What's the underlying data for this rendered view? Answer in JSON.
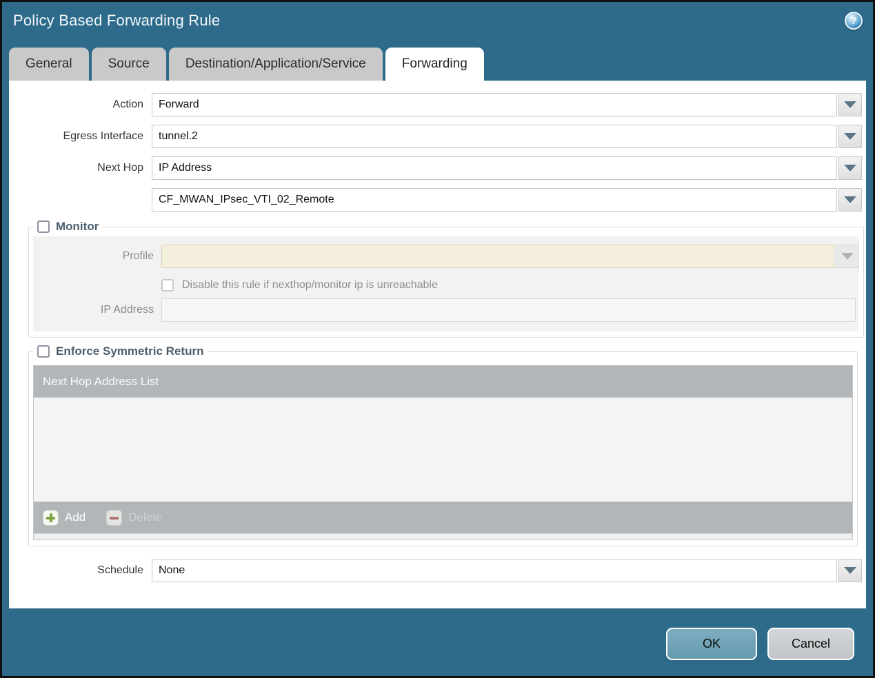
{
  "window": {
    "title": "Policy Based Forwarding Rule",
    "help_icon_glyph": "?"
  },
  "tabs": [
    {
      "label": "General",
      "active": false
    },
    {
      "label": "Source",
      "active": false
    },
    {
      "label": "Destination/Application/Service",
      "active": false
    },
    {
      "label": "Forwarding",
      "active": true
    }
  ],
  "form": {
    "action": {
      "label": "Action",
      "value": "Forward"
    },
    "egress_interface": {
      "label": "Egress Interface",
      "value": "tunnel.2"
    },
    "next_hop": {
      "label": "Next Hop",
      "value": "IP Address"
    },
    "next_hop_address": {
      "value": "CF_MWAN_IPsec_VTI_02_Remote"
    },
    "schedule": {
      "label": "Schedule",
      "value": "None"
    }
  },
  "monitor": {
    "legend": "Monitor",
    "checked": false,
    "profile_label": "Profile",
    "profile_value": "",
    "disable_rule_label": "Disable this rule if nexthop/monitor ip is unreachable",
    "disable_rule_checked": false,
    "ip_address_label": "IP Address",
    "ip_address_value": ""
  },
  "symmetric_return": {
    "legend": "Enforce Symmetric Return",
    "checked": false,
    "table_header": "Next Hop Address List",
    "rows": [],
    "add_label": "Add",
    "delete_label": "Delete",
    "delete_enabled": false
  },
  "footer": {
    "ok_label": "OK",
    "cancel_label": "Cancel"
  },
  "colors": {
    "chrome_teal": "#2e6b8b",
    "tab_inactive": "#c9c9c9",
    "grid_chrome": "#b2b6b9",
    "disabled_field_beige": "#f5f0dd",
    "section_bg": "#f2f2f2",
    "ok_button": "#6fa3b7",
    "cancel_button": "#c8cbce",
    "add_plus_green": "#7fa33e",
    "delete_minus_red": "#b07473"
  }
}
